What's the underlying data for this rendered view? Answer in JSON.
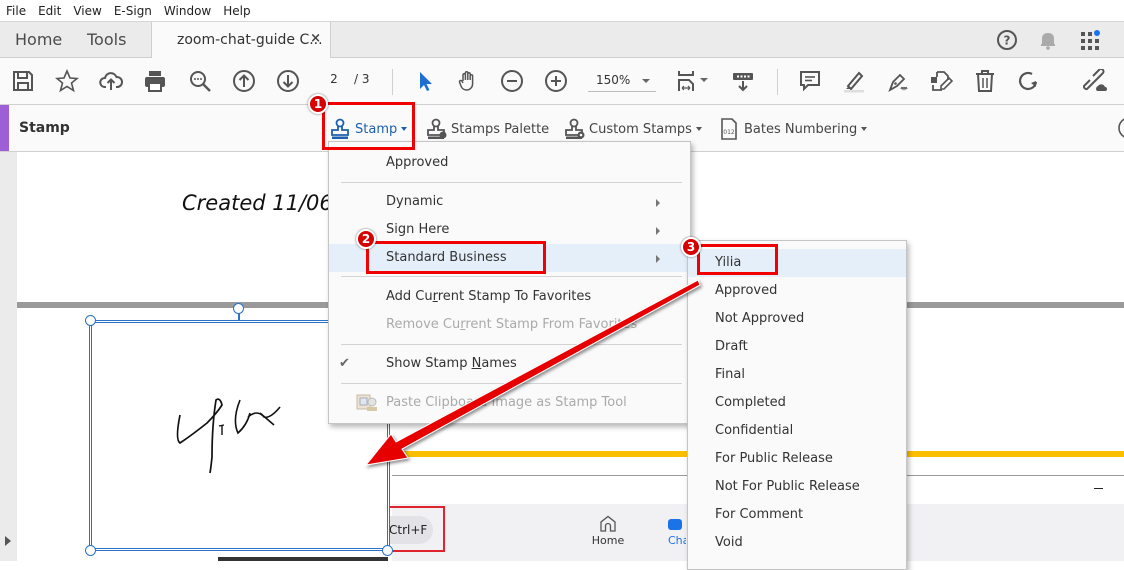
{
  "menubar": {
    "items": [
      "File",
      "Edit",
      "View",
      "E-Sign",
      "Window",
      "Help"
    ]
  },
  "tabs": {
    "home": "Home",
    "tools": "Tools",
    "document": "zoom-chat-guide C...",
    "close_symbol": "×"
  },
  "toolbar": {
    "current_page": "2",
    "total_pages": "/ 3",
    "zoom_level": "150%",
    "icons": [
      "save-icon",
      "bookmark-star-icon",
      "upload-cloud-icon",
      "print-icon",
      "search-zoom-icon",
      "page-up-icon",
      "page-down-icon",
      "select-cursor-icon",
      "hand-icon",
      "zoom-out-icon",
      "zoom-in-icon",
      "fit-page-icon",
      "scroll-mode-icon",
      "comment-icon",
      "highlight-icon",
      "sign-pen-icon",
      "edit-pdf-icon",
      "delete-icon",
      "rotate-icon",
      "share-link-icon"
    ]
  },
  "stamp_toolbar": {
    "title": "Stamp",
    "stamp_button": "Stamp",
    "stamps_palette": "Stamps Palette",
    "custom_stamps": "Custom Stamps",
    "bates_numbering": "Bates Numbering",
    "accent_color": "#9e5fd6"
  },
  "stamp_menu": {
    "items": [
      {
        "label": "Approved"
      },
      {
        "label": "Dynamic",
        "submenu": true
      },
      {
        "label": "Sign Here",
        "submenu": true
      },
      {
        "label": "Standard Business",
        "submenu": true,
        "highlighted": true
      },
      {
        "label_before": "Add Cu",
        "label_ul": "r",
        "label_after": "rent Stamp To Favorites"
      },
      {
        "label_before": "Remove Cu",
        "label_ul": "r",
        "label_after": "rent Stamp From Favorites",
        "disabled": true
      },
      {
        "label_before": "Show Stamp ",
        "label_ul": "N",
        "label_after": "ames",
        "checked": true,
        "check_symbol": "✔"
      },
      {
        "label": "Paste Clipboard Image as Stamp Tool",
        "disabled": true
      }
    ]
  },
  "standard_business_submenu": {
    "items": [
      "Yilia",
      "Approved",
      "Not Approved",
      "Draft",
      "Final",
      "Completed",
      "Confidential",
      "For Public Release",
      "Not For Public Release",
      "For Comment",
      "Void"
    ],
    "highlighted": "Yilia"
  },
  "document": {
    "created_text": "Created 11/06",
    "stamp_signature": "Yilia",
    "zoom_search_hint": "Ctrl+F",
    "zoom_nav_home": "Home",
    "zoom_nav_chat": "Chat",
    "minimize_symbol": "–"
  },
  "annotations": {
    "step1": "1",
    "step2": "2",
    "step3": "3",
    "color": "#f00000"
  }
}
